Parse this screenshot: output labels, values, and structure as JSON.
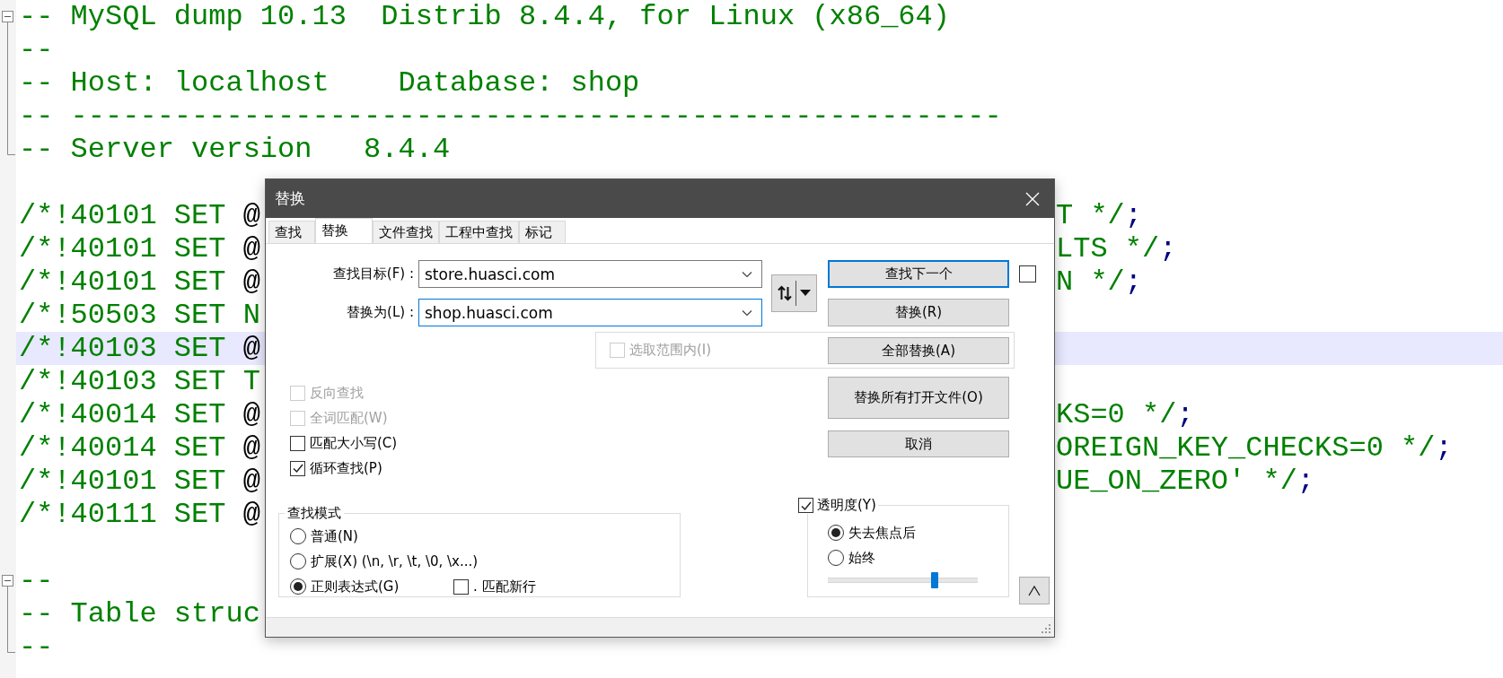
{
  "editor": {
    "lines": [
      {
        "current": false,
        "kind": "fold_start",
        "segments": [
          {
            "text": "-- MySQL dump 10.13  Distrib 8.4.4, for Linux (x86_64)",
            "kind": "comment"
          }
        ]
      },
      {
        "current": false,
        "kind": "fold_middle",
        "segments": [
          {
            "text": "--",
            "kind": "comment"
          }
        ]
      },
      {
        "current": false,
        "kind": "fold_middle",
        "segments": [
          {
            "text": "-- Host: localhost    Database: shop",
            "kind": "comment"
          }
        ]
      },
      {
        "current": false,
        "kind": "fold_middle",
        "segments": [
          {
            "text": "-- ------------------------------------------------------",
            "kind": "comment"
          }
        ]
      },
      {
        "current": false,
        "kind": "fold_end",
        "segments": [
          {
            "text": "-- Server version   8.4.4",
            "kind": "comment"
          }
        ]
      },
      {
        "current": false
      },
      {
        "current": false,
        "segments": [
          {
            "text": "/*!40101 SET ",
            "kind": "comment"
          },
          {
            "text": "@",
            "kind": "plain"
          }
        ],
        "tail": [
          {
            "text": "T */",
            "kind": "comment"
          },
          {
            "text": ";",
            "kind": "operator"
          }
        ]
      },
      {
        "current": false,
        "segments": [
          {
            "text": "/*!40101 SET ",
            "kind": "comment"
          },
          {
            "text": "@",
            "kind": "plain"
          }
        ],
        "tail": [
          {
            "text": "LTS */",
            "kind": "comment"
          },
          {
            "text": ";",
            "kind": "operator"
          }
        ]
      },
      {
        "current": false,
        "segments": [
          {
            "text": "/*!40101 SET ",
            "kind": "comment"
          },
          {
            "text": "@",
            "kind": "plain"
          }
        ],
        "tail": [
          {
            "text": "N */",
            "kind": "comment"
          },
          {
            "text": ";",
            "kind": "operator"
          }
        ]
      },
      {
        "current": false,
        "segments": [
          {
            "text": "/*!50503 SET N",
            "kind": "comment"
          }
        ]
      },
      {
        "current": true,
        "segments": [
          {
            "text": "/*!40103 SET ",
            "kind": "comment"
          },
          {
            "text": "@",
            "kind": "plain"
          }
        ]
      },
      {
        "current": false,
        "segments": [
          {
            "text": "/*!40103 SET T",
            "kind": "comment"
          }
        ]
      },
      {
        "current": false,
        "segments": [
          {
            "text": "/*!40014 SET ",
            "kind": "comment"
          },
          {
            "text": "@",
            "kind": "plain"
          }
        ],
        "tail": [
          {
            "text": "KS=0 */",
            "kind": "comment"
          },
          {
            "text": ";",
            "kind": "operator"
          }
        ]
      },
      {
        "current": false,
        "segments": [
          {
            "text": "/*!40014 SET ",
            "kind": "comment"
          },
          {
            "text": "@",
            "kind": "plain"
          }
        ],
        "tail": [
          {
            "text": "OREIGN_KEY_CHECKS=0 */",
            "kind": "comment"
          },
          {
            "text": ";",
            "kind": "operator"
          }
        ]
      },
      {
        "current": false,
        "segments": [
          {
            "text": "/*!40101 SET ",
            "kind": "comment"
          },
          {
            "text": "@",
            "kind": "plain"
          }
        ],
        "tail": [
          {
            "text": "UE_ON_ZERO' */",
            "kind": "comment"
          },
          {
            "text": ";",
            "kind": "operator"
          }
        ]
      },
      {
        "current": false,
        "segments": [
          {
            "text": "/*!40111 SET ",
            "kind": "comment"
          },
          {
            "text": "@",
            "kind": "plain"
          }
        ]
      },
      {
        "current": false
      },
      {
        "current": false,
        "kind": "fold_start",
        "segments": [
          {
            "text": "--",
            "kind": "comment"
          }
        ]
      },
      {
        "current": false,
        "kind": "fold_middle",
        "segments": [
          {
            "text": "-- Table struc",
            "kind": "comment"
          }
        ]
      },
      {
        "current": false,
        "kind": "fold_end",
        "segments": [
          {
            "text": "--",
            "kind": "comment"
          }
        ]
      }
    ]
  },
  "dialog": {
    "title": "替换",
    "tabs": [
      {
        "label": "查找",
        "selected": false
      },
      {
        "label": "替换",
        "selected": true
      },
      {
        "label": "文件查找",
        "selected": false
      },
      {
        "label": "工程中查找",
        "selected": false
      },
      {
        "label": "标记",
        "selected": false
      }
    ],
    "fields": [
      {
        "label": "查找目标(F) :",
        "value": "store.huasci.com",
        "focused": false
      },
      {
        "label": "替换为(L) :",
        "value": "shop.huasci.com",
        "focused": true
      }
    ],
    "buttons": [
      {
        "label": "查找下一个",
        "default": true
      },
      {
        "label": "替换(R)",
        "default": false
      },
      {
        "label": "全部替换(A)",
        "default": false
      },
      {
        "label": "替换所有打开文件(O)",
        "default": false
      },
      {
        "label": "取消",
        "default": false
      }
    ],
    "side_option": {
      "checked": false
    },
    "in_selection": {
      "label": "选取范围内(I)",
      "checked": false,
      "disabled": true
    },
    "options": [
      {
        "label": "反向查找",
        "checked": false,
        "disabled": true
      },
      {
        "label": "全词匹配(W)",
        "checked": false,
        "disabled": true
      },
      {
        "label": "匹配大小写(C)",
        "checked": false,
        "disabled": false
      },
      {
        "label": "循环查找(P)",
        "checked": true,
        "disabled": false
      }
    ],
    "search_mode": {
      "title": "查找模式",
      "modes": [
        {
          "label": "普通(N)",
          "selected": false
        },
        {
          "label": "扩展(X) (\\n, \\r, \\t, \\0, \\x...)",
          "selected": false
        },
        {
          "label": "正则表达式(G)",
          "selected": true
        }
      ],
      "dot_newline": {
        "label": ". 匹配新行",
        "checked": false
      }
    },
    "transparency": {
      "label": "透明度(Y)",
      "checked": true,
      "modes": [
        {
          "label": "失去焦点后",
          "selected": true
        },
        {
          "label": "始终",
          "selected": false
        }
      ],
      "level": 0.71
    }
  }
}
